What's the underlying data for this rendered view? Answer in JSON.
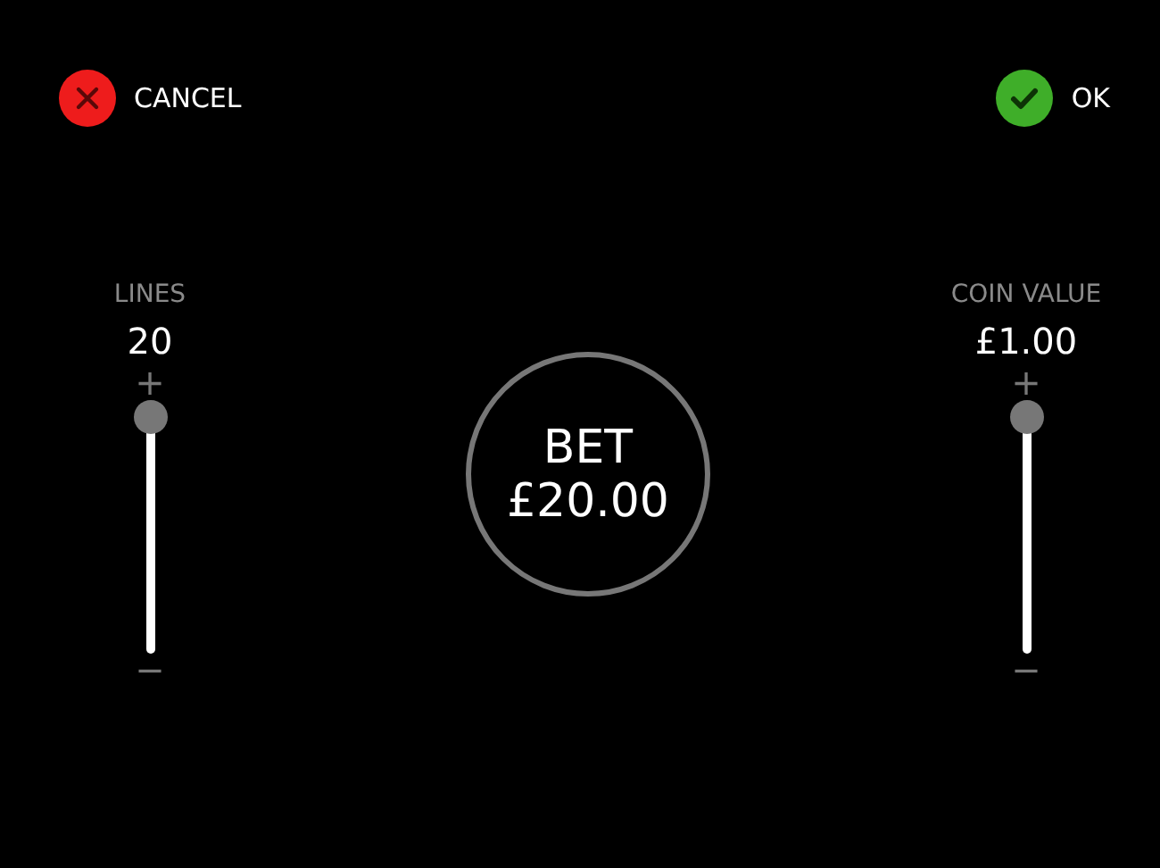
{
  "cancel_button": {
    "label": "CANCEL"
  },
  "ok_button": {
    "label": "OK"
  },
  "sliders": [
    {
      "label": "LINES",
      "value": "20",
      "plus": "+",
      "minus": "−",
      "level": 1
    },
    {
      "label": "COIN VALUE",
      "value": "£1.00",
      "plus": "+",
      "minus": "−",
      "level": 1
    }
  ],
  "bet": {
    "label": "BET",
    "amount": "£20.00"
  }
}
